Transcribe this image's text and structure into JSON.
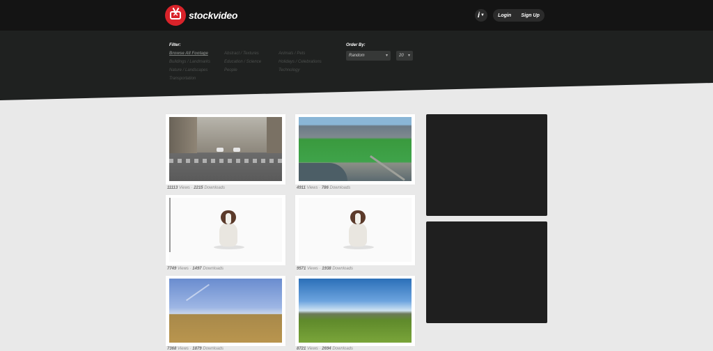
{
  "brand": {
    "name": "stockvideo"
  },
  "header": {
    "info_label": "i",
    "login_label": "Login",
    "signup_label": "Sign Up"
  },
  "filter": {
    "title": "Filter:",
    "categories": [
      "Browse All Footage",
      "Abstract / Textures",
      "Animals / Pets",
      "Buildings / Landmarks",
      "Education / Science",
      "Holidays / Celebrations",
      "Nature / Landscapes",
      "People",
      "Technology",
      "Transportation"
    ]
  },
  "order": {
    "title": "Order By:",
    "sort_value": "Random",
    "count_value": "20"
  },
  "videos": [
    {
      "views": "11113",
      "downloads": "2215",
      "thumb": "street-crosswalk"
    },
    {
      "views": "4911",
      "downloads": "786",
      "thumb": "city-aerial"
    },
    {
      "views": "7749",
      "downloads": "1497",
      "thumb": "dog-white"
    },
    {
      "views": "9571",
      "downloads": "1938",
      "thumb": "dog-white"
    },
    {
      "views": "7368",
      "downloads": "1879",
      "thumb": "wheat-field-sky"
    },
    {
      "views": "8721",
      "downloads": "2694",
      "thumb": "green-field-mountains"
    }
  ],
  "labels": {
    "views": "Views",
    "downloads": "Downloads",
    "separator": "·"
  }
}
